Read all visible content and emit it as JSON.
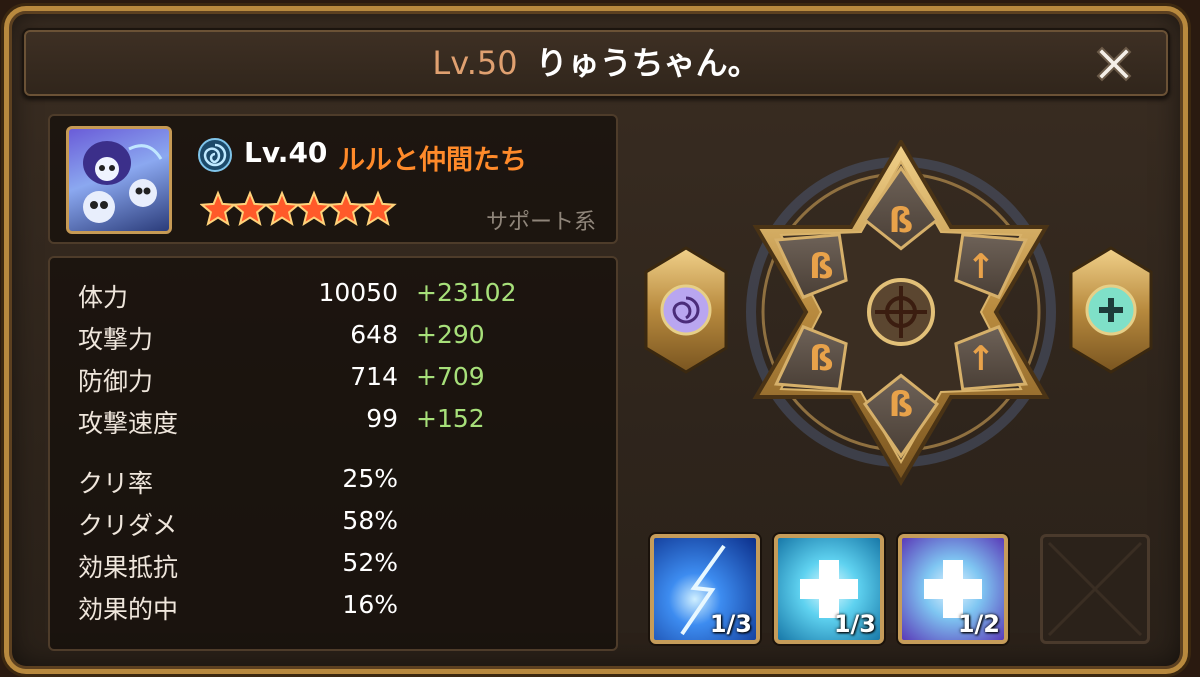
{
  "header": {
    "level": "Lv.50",
    "name": "りゅうちゃん。"
  },
  "hero": {
    "level": "Lv.40",
    "name": "ルルと仲間たち",
    "type": "サポート系",
    "stars": 6,
    "element_icon": "wind-element-icon"
  },
  "stats": [
    {
      "label": "体力",
      "value": "10050",
      "bonus": "+23102"
    },
    {
      "label": "攻撃力",
      "value": "648",
      "bonus": "+290"
    },
    {
      "label": "防御力",
      "value": "714",
      "bonus": "+709"
    },
    {
      "label": "攻撃速度",
      "value": "99",
      "bonus": "+152"
    },
    {
      "label": "クリ率",
      "value": "25%",
      "bonus": ""
    },
    {
      "label": "クリダメ",
      "value": "58%",
      "bonus": ""
    },
    {
      "label": "効果抵抗",
      "value": "52%",
      "bonus": ""
    },
    {
      "label": "効果的中",
      "value": "16%",
      "bonus": ""
    }
  ],
  "runes": {
    "slots": [
      "rune-b-icon",
      "rune-arrow-icon",
      "rune-arrow-icon",
      "rune-b-icon",
      "rune-b-icon",
      "rune-b-icon"
    ],
    "left_artifact": "element-artifact-icon",
    "right_artifact": "type-artifact-icon"
  },
  "skills": [
    {
      "icon": "lightning-skill-icon",
      "count": "1/3"
    },
    {
      "icon": "heal-cross-skill-icon",
      "count": "1/3"
    },
    {
      "icon": "heal-cross-skill-icon",
      "count": "1/2"
    }
  ],
  "colors": {
    "frame_gold": "#b8893e",
    "name_orange": "#ff8a2a",
    "bonus_green": "#a7e07a",
    "level_peach": "#e0a070"
  }
}
